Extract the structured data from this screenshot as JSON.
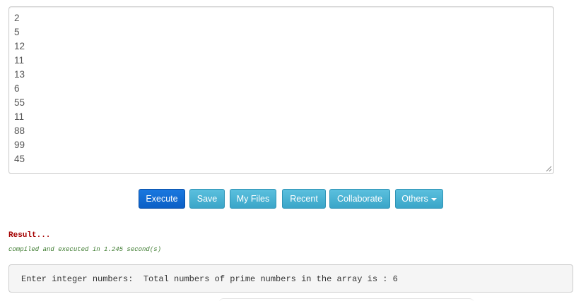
{
  "stdin": {
    "lines": [
      "2",
      "5",
      "12",
      "11",
      "13",
      "6",
      "55",
      "11",
      "88",
      "99",
      "45"
    ]
  },
  "toolbar": {
    "execute_label": "Execute",
    "save_label": "Save",
    "my_files_label": "My Files",
    "recent_label": "Recent",
    "collaborate_label": "Collaborate",
    "others_label": "Others"
  },
  "result": {
    "title": "Result...",
    "meta": "compiled and executed in 1.245 second(s)",
    "output": "Enter integer numbers:  Total numbers of prime numbers in the array is : 6"
  },
  "colors": {
    "primary": "#0b5fc6",
    "info": "#5bc0de",
    "result_title": "#a40000",
    "result_meta": "#3c7a2e"
  }
}
